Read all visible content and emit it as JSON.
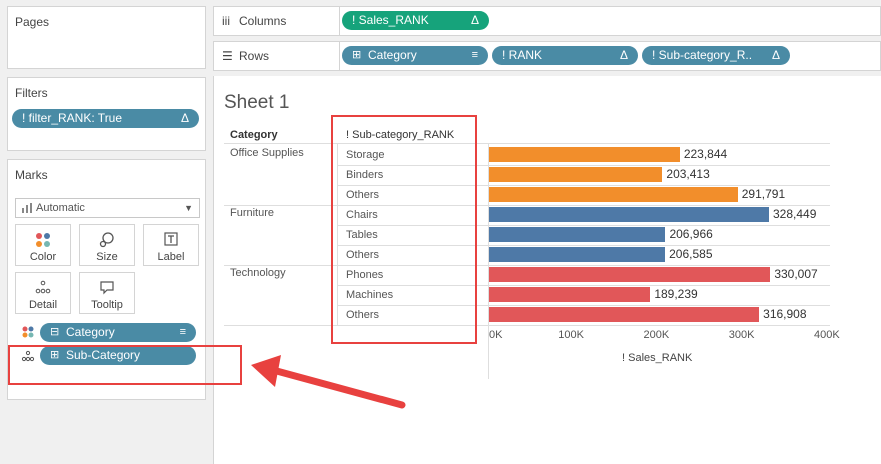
{
  "left_panel": {
    "pages_title": "Pages",
    "filters_title": "Filters",
    "filter_pill": "! filter_RANK: True",
    "marks_title": "Marks",
    "mark_type": "Automatic",
    "buttons": {
      "color": "Color",
      "size": "Size",
      "label": "Label",
      "detail": "Detail",
      "tooltip": "Tooltip"
    },
    "marks_fields": {
      "color_field": "Category",
      "detail_field": "Sub-Category"
    }
  },
  "shelves": {
    "columns_label": "Columns",
    "rows_label": "Rows",
    "columns_pill": "! Sales_RANK",
    "rows_pills": [
      "Category",
      "! RANK",
      "! Sub-category_R.."
    ]
  },
  "view": {
    "sheet_title": "Sheet 1",
    "col_header_category": "Category",
    "col_header_subcategory": "! Sub-category_RANK",
    "categories": [
      "Office Supplies",
      "Furniture",
      "Technology"
    ],
    "colors": {
      "Office Supplies": "#f28e2b",
      "Furniture": "#4e79a7",
      "Technology": "#e15759"
    },
    "rows": [
      {
        "category": "Office Supplies",
        "sub": "Storage",
        "value": 223844,
        "label": "223,844"
      },
      {
        "category": "Office Supplies",
        "sub": "Binders",
        "value": 203413,
        "label": "203,413"
      },
      {
        "category": "Office Supplies",
        "sub": "Others",
        "value": 291791,
        "label": "291,791"
      },
      {
        "category": "Furniture",
        "sub": "Chairs",
        "value": 328449,
        "label": "328,449"
      },
      {
        "category": "Furniture",
        "sub": "Tables",
        "value": 206966,
        "label": "206,966"
      },
      {
        "category": "Furniture",
        "sub": "Others",
        "value": 206585,
        "label": "206,585"
      },
      {
        "category": "Technology",
        "sub": "Phones",
        "value": 330007,
        "label": "330,007"
      },
      {
        "category": "Technology",
        "sub": "Machines",
        "value": 189239,
        "label": "189,239"
      },
      {
        "category": "Technology",
        "sub": "Others",
        "value": 316908,
        "label": "316,908"
      }
    ],
    "axis_ticks": [
      "0K",
      "100K",
      "200K",
      "300K",
      "400K"
    ],
    "axis_max": 400000,
    "axis_title": "! Sales_RANK"
  },
  "annotation_color": "#e8413f"
}
